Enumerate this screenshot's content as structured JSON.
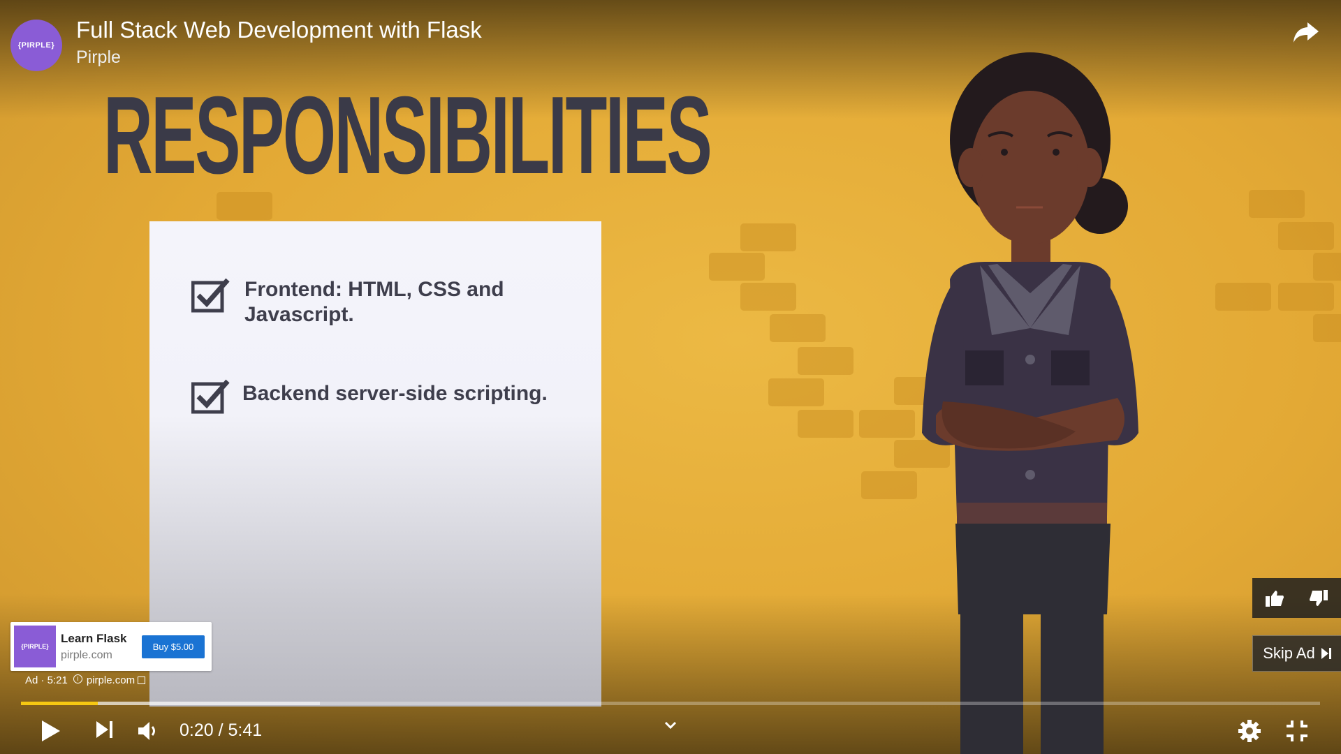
{
  "header": {
    "channel_avatar_text": "{PIRPLE}",
    "video_title": "Full Stack Web Development with Flask",
    "channel_name": "Pirple",
    "share_icon": "share-icon"
  },
  "slide": {
    "heading": "RESPONSIBILITIES",
    "items": [
      {
        "text": "Frontend: HTML, CSS and Javascript.",
        "checked": true
      },
      {
        "text": "Backend server-side scripting.",
        "checked": true
      }
    ]
  },
  "ad": {
    "thumb_text": "{PIRPLE}",
    "title": "Learn Flask",
    "domain": "pirple.com",
    "buy_label": "Buy $5.00",
    "meta_label": "Ad · 5:21",
    "meta_domain": "pirple.com",
    "skip_label": "Skip Ad"
  },
  "controls": {
    "time_display": "0:20 / 5:41",
    "played_fraction": 0.059,
    "buffered_fraction": 0.23
  },
  "colors": {
    "background": "#e6ad3a",
    "brand_purple": "#8a5cd6",
    "progress": "#f6c812",
    "buy_button": "#1a73d3"
  }
}
